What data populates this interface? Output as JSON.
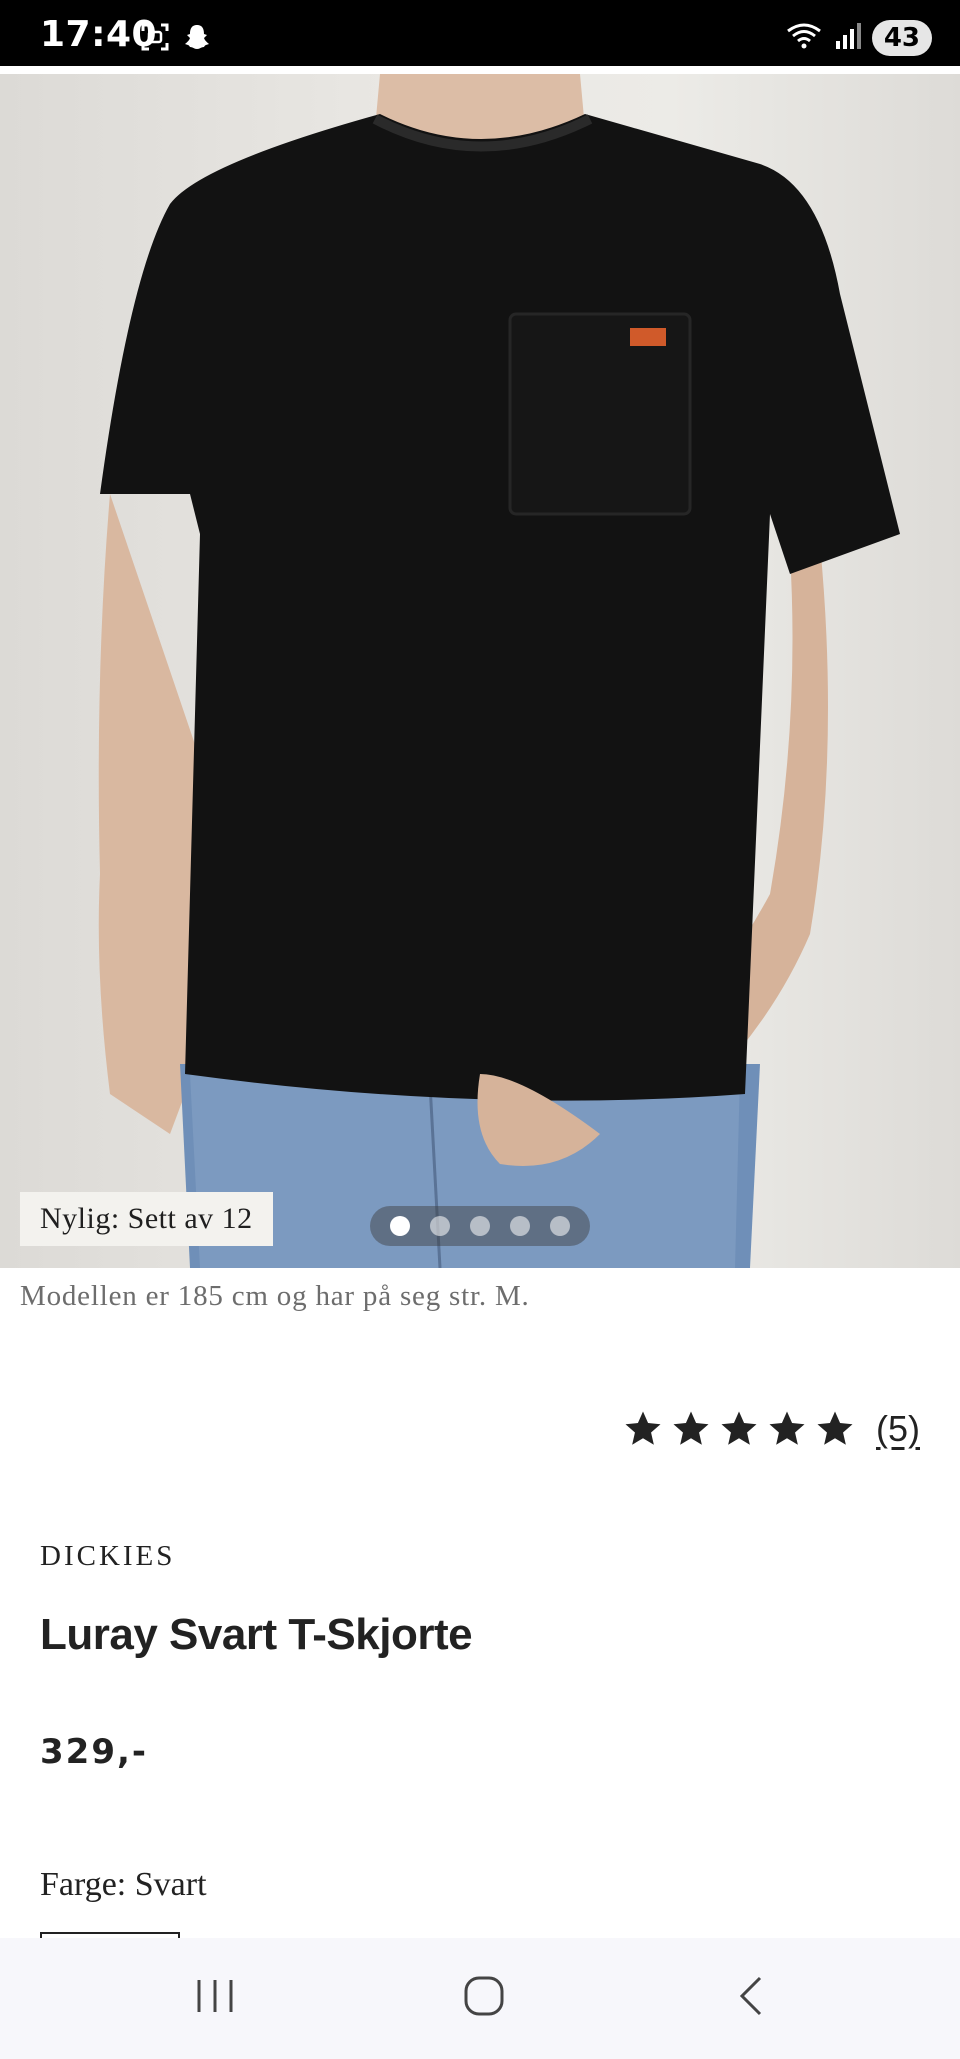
{
  "status_bar": {
    "time": "17:40",
    "battery": "43",
    "icons": [
      "screenshot-icon",
      "snapchat-icon",
      "wifi-icon",
      "signal-icon"
    ]
  },
  "gallery": {
    "dot_count": 5,
    "active_index": 0,
    "recent_badge": "Nylig: Sett av 12",
    "model_note": "Modellen er 185 cm og har på seg str. M."
  },
  "rating": {
    "stars": 5,
    "max": 5,
    "count_label": "(5)"
  },
  "product": {
    "brand": "DICKIES",
    "title": "Luray Svart T-Skjorte",
    "price": "329,-",
    "color_label": "Farge: Svart"
  },
  "colors": {
    "status_bar_bg": "#000000",
    "shirt": "#121212",
    "text": "#222222",
    "nav_bg": "#f7f7fb"
  },
  "nav": {
    "buttons": [
      "recent-apps-icon",
      "home-icon",
      "back-icon"
    ]
  }
}
